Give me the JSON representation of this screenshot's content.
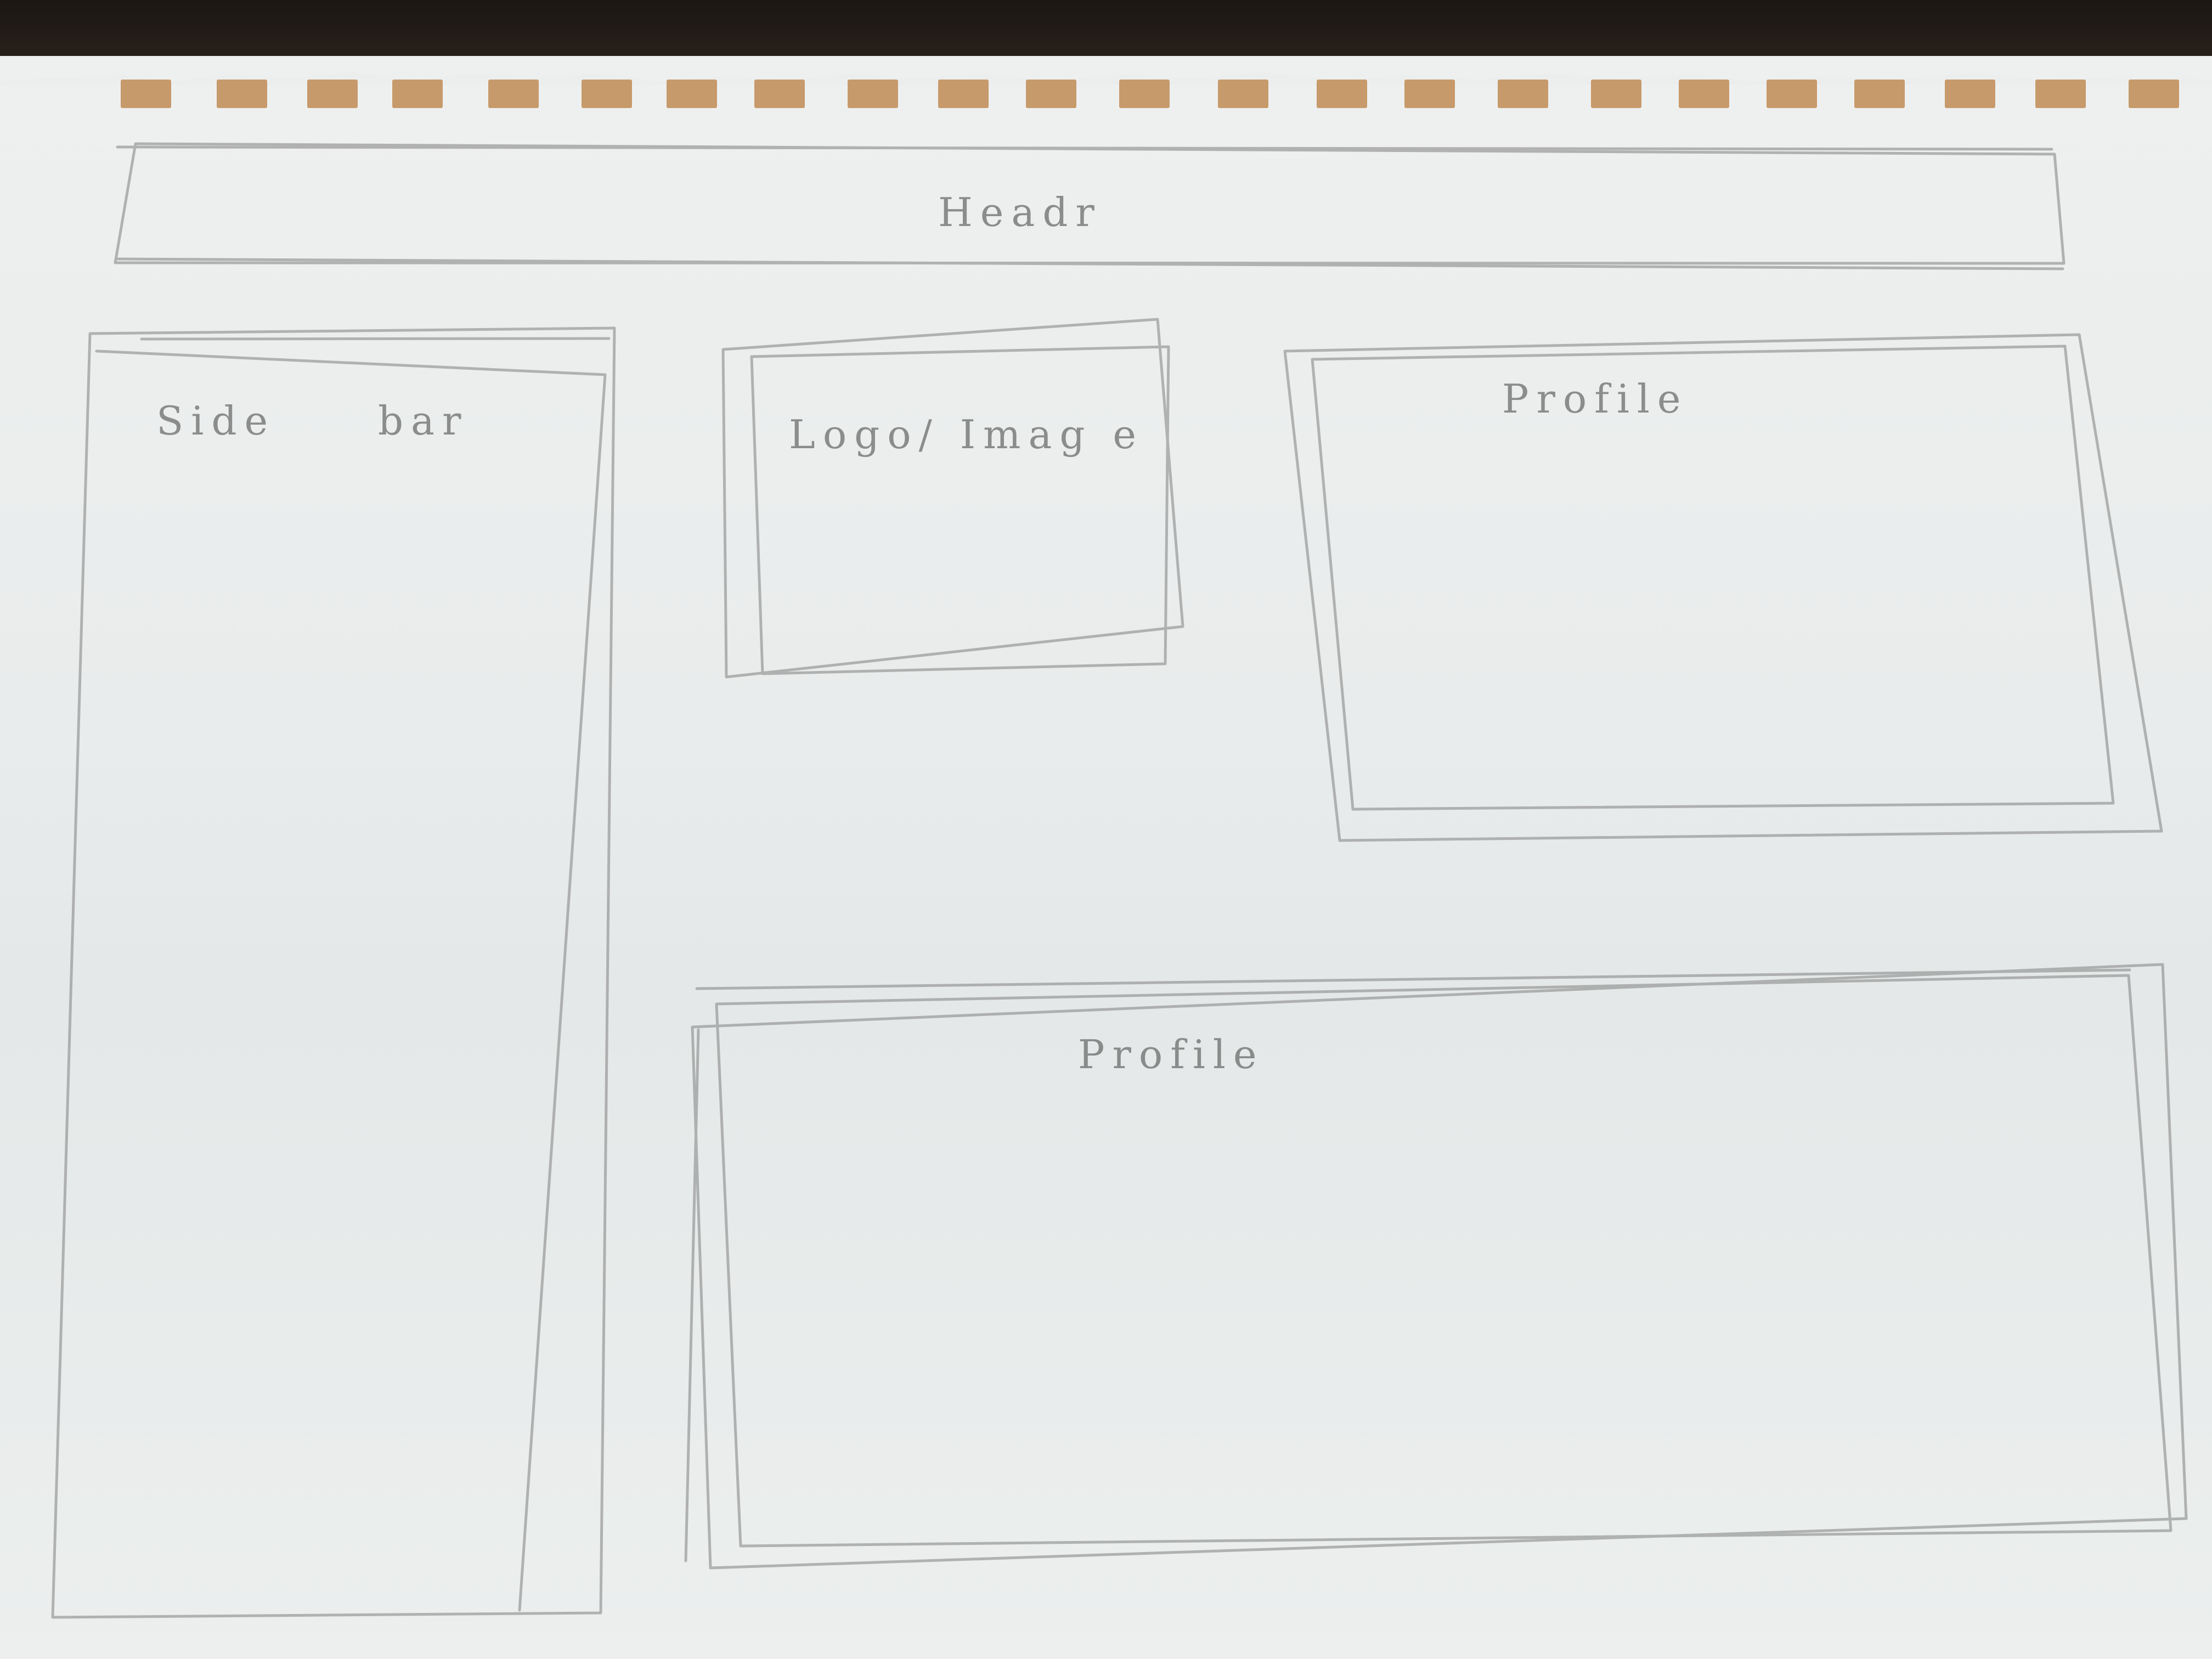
{
  "wireframe": {
    "header_label": "Headr",
    "sidebar_label": "Side bar",
    "logo_label": "Logo/ Imag e",
    "profile_top_label": "Profile",
    "profile_bottom_label": "Profile"
  },
  "colors": {
    "paper": "#eceeee",
    "pencil": "#8a8a8a",
    "background": "#c49668"
  }
}
